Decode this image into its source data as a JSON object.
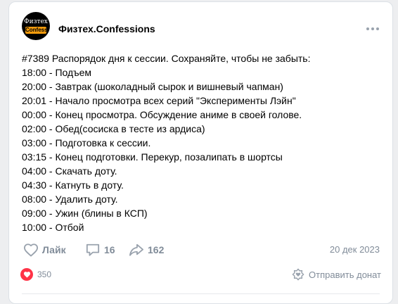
{
  "post": {
    "author": {
      "name": "Физтех.Confessions",
      "avatar_top": "Физтех",
      "avatar_bottom": "Confess"
    },
    "lines": [
      "#7389 Распорядок дня к сессии. Сохраняйте, чтобы не забыть:",
      "18:00 - Подъем",
      "20:00 - Завтрак (шоколадный сырок и вишневый чапман)",
      "20:01 - Начало просмотра всех серий \"Эксперименты Лэйн\"",
      "00:00 - Конец просмотра. Обсуждение аниме в своей голове.",
      "02:00 - Обед(сосиска в тесте из ардиса)",
      "03:00 - Подготовка к сессии.",
      "03:15 - Конец подготовки. Перекур, позалипать в шортсы",
      "04:00 - Скачать доту.",
      "04:30 - Катнуть в доту.",
      "08:00 - Удалить доту.",
      "09:00 - Ужин (блины в КСП)",
      "10:00 - Отбой"
    ],
    "actions": {
      "like_label": "Лайк",
      "comments_count": "16",
      "shares_count": "162"
    },
    "date": "20 дек 2023",
    "reactions_count": "350",
    "donate_label": "Отправить донат"
  },
  "icons": {
    "more": "more-horizontal-icon",
    "like": "heart-outline-icon",
    "comment": "comment-icon",
    "share": "share-arrow-icon",
    "reaction": "heart-filled-icon",
    "donate": "donate-icon"
  },
  "colors": {
    "page_background": "#edeef0",
    "card_background": "#ffffff",
    "text_primary": "#000000",
    "text_secondary": "#818c99",
    "icon_gray": "#99a2ad",
    "reaction_red": "#ff3347",
    "avatar_accent": "#f29b0d"
  }
}
